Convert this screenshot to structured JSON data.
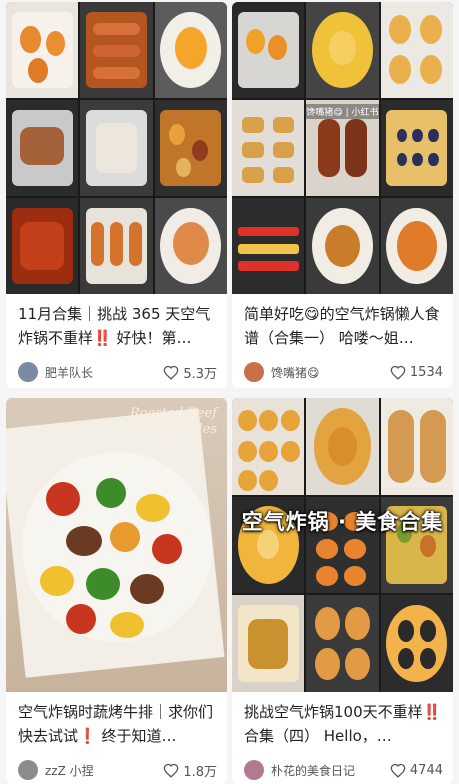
{
  "cards": [
    {
      "title": "11月合集｜挑战 365 天空气炸锅不重样‼️ 好快！第…",
      "author": "肥羊队长",
      "likes": "5.3万",
      "avatar_color": "#7a8aa0"
    },
    {
      "title": "简单好吃😋的空气炸锅懒人食谱（合集一） 哈喽～姐…",
      "author": "馋嘴猪😋",
      "likes": "1534",
      "avatar_color": "#c9704a",
      "overlay_tag": "馋嘴猪😋 | 小红书"
    },
    {
      "title": "空气炸锅时蔬烤牛排｜求你们快去试试❗ 终于知道…",
      "author": "zzZ 小捏",
      "likes": "1.8万",
      "avatar_color": "#8c8c8c",
      "image_title_line1": "Roasted Beef",
      "image_title_line2": "& Vegetables"
    },
    {
      "title": "挑战空气炸锅100天不重样‼️合集（四） Hello，…",
      "author": "朴花的美食日记",
      "likes": "4744",
      "avatar_color": "#b07a92",
      "banner": "空气炸锅 · 美食合集"
    }
  ],
  "icons": {
    "like": "heart-outline-icon"
  },
  "colors": {
    "feed_bg": "#f5f5f5",
    "card_bg": "#ffffff",
    "text": "#222222",
    "muted": "#555555"
  }
}
